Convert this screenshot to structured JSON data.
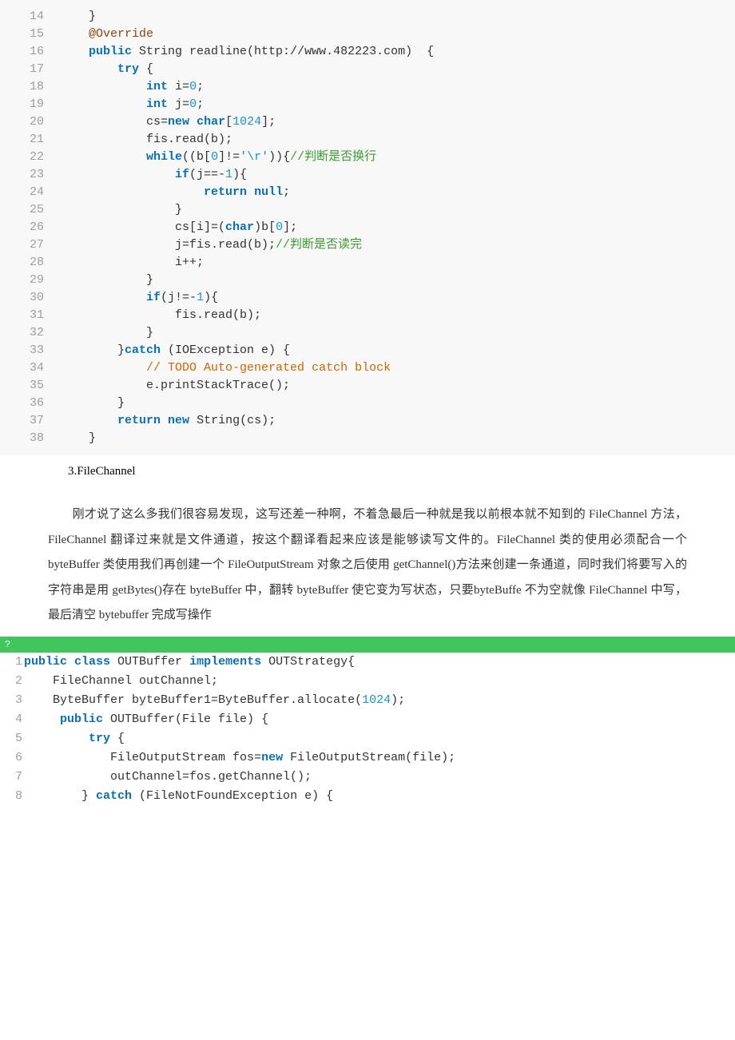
{
  "code1": [
    {
      "n": "14",
      "tokens": [
        {
          "t": "    }",
          "c": ""
        }
      ]
    },
    {
      "n": "15",
      "tokens": [
        {
          "t": "    @Override",
          "c": "brown"
        }
      ]
    },
    {
      "n": "16",
      "tokens": [
        {
          "t": "    ",
          "c": ""
        },
        {
          "t": "public",
          "c": "kw"
        },
        {
          "t": " String readline(http://www.482223.com)  {",
          "c": ""
        }
      ]
    },
    {
      "n": "17",
      "tokens": [
        {
          "t": "        ",
          "c": ""
        },
        {
          "t": "try",
          "c": "kw"
        },
        {
          "t": " {",
          "c": ""
        }
      ]
    },
    {
      "n": "18",
      "tokens": [
        {
          "t": "            ",
          "c": ""
        },
        {
          "t": "int",
          "c": "kw"
        },
        {
          "t": " i=",
          "c": ""
        },
        {
          "t": "0",
          "c": "num"
        },
        {
          "t": ";",
          "c": ""
        }
      ]
    },
    {
      "n": "19",
      "tokens": [
        {
          "t": "            ",
          "c": ""
        },
        {
          "t": "int",
          "c": "kw"
        },
        {
          "t": " j=",
          "c": ""
        },
        {
          "t": "0",
          "c": "num"
        },
        {
          "t": ";",
          "c": ""
        }
      ]
    },
    {
      "n": "20",
      "tokens": [
        {
          "t": "            cs=",
          "c": ""
        },
        {
          "t": "new",
          "c": "kw"
        },
        {
          "t": " ",
          "c": ""
        },
        {
          "t": "char",
          "c": "kw"
        },
        {
          "t": "[",
          "c": ""
        },
        {
          "t": "1024",
          "c": "num"
        },
        {
          "t": "];",
          "c": ""
        }
      ]
    },
    {
      "n": "21",
      "tokens": [
        {
          "t": "            fis.read(b);",
          "c": ""
        }
      ]
    },
    {
      "n": "22",
      "tokens": [
        {
          "t": "            ",
          "c": ""
        },
        {
          "t": "while",
          "c": "kw"
        },
        {
          "t": "((b[",
          "c": ""
        },
        {
          "t": "0",
          "c": "num"
        },
        {
          "t": "]!=",
          "c": ""
        },
        {
          "t": "'\\r'",
          "c": "str"
        },
        {
          "t": ")){",
          "c": ""
        },
        {
          "t": "//判断是否换行",
          "c": "cmt-g"
        }
      ]
    },
    {
      "n": "23",
      "tokens": [
        {
          "t": "                ",
          "c": ""
        },
        {
          "t": "if",
          "c": "kw"
        },
        {
          "t": "(j==-",
          "c": ""
        },
        {
          "t": "1",
          "c": "num"
        },
        {
          "t": "){",
          "c": ""
        }
      ]
    },
    {
      "n": "24",
      "tokens": [
        {
          "t": "                    ",
          "c": ""
        },
        {
          "t": "return",
          "c": "kw"
        },
        {
          "t": " ",
          "c": ""
        },
        {
          "t": "null",
          "c": "kw"
        },
        {
          "t": ";",
          "c": ""
        }
      ]
    },
    {
      "n": "25",
      "tokens": [
        {
          "t": "                }",
          "c": ""
        }
      ]
    },
    {
      "n": "26",
      "tokens": [
        {
          "t": "                cs[i]=(",
          "c": ""
        },
        {
          "t": "char",
          "c": "kw"
        },
        {
          "t": ")b[",
          "c": ""
        },
        {
          "t": "0",
          "c": "num"
        },
        {
          "t": "];",
          "c": ""
        }
      ]
    },
    {
      "n": "27",
      "tokens": [
        {
          "t": "                j=fis.read(b);",
          "c": ""
        },
        {
          "t": "//判断是否读完",
          "c": "cmt-g"
        }
      ]
    },
    {
      "n": "28",
      "tokens": [
        {
          "t": "                i++;",
          "c": ""
        }
      ]
    },
    {
      "n": "29",
      "tokens": [
        {
          "t": "            }",
          "c": ""
        }
      ]
    },
    {
      "n": "30",
      "tokens": [
        {
          "t": "            ",
          "c": ""
        },
        {
          "t": "if",
          "c": "kw"
        },
        {
          "t": "(j!=-",
          "c": ""
        },
        {
          "t": "1",
          "c": "num"
        },
        {
          "t": "){",
          "c": ""
        }
      ]
    },
    {
      "n": "31",
      "tokens": [
        {
          "t": "                fis.read(b);",
          "c": ""
        }
      ]
    },
    {
      "n": "32",
      "tokens": [
        {
          "t": "            }",
          "c": ""
        }
      ]
    },
    {
      "n": "33",
      "tokens": [
        {
          "t": "        }",
          "c": ""
        },
        {
          "t": "catch",
          "c": "kw"
        },
        {
          "t": " (IOException e) {",
          "c": ""
        }
      ]
    },
    {
      "n": "34",
      "tokens": [
        {
          "t": "            ",
          "c": ""
        },
        {
          "t": "// TODO Auto-generated catch block",
          "c": "cmt-o"
        }
      ]
    },
    {
      "n": "35",
      "tokens": [
        {
          "t": "            e.printStackTrace();",
          "c": ""
        }
      ]
    },
    {
      "n": "36",
      "tokens": [
        {
          "t": "        }",
          "c": ""
        }
      ]
    },
    {
      "n": "37",
      "tokens": [
        {
          "t": "        ",
          "c": ""
        },
        {
          "t": "return",
          "c": "kw"
        },
        {
          "t": " ",
          "c": ""
        },
        {
          "t": "new",
          "c": "kw"
        },
        {
          "t": " String(cs);",
          "c": ""
        }
      ]
    },
    {
      "n": "38",
      "tokens": [
        {
          "t": "    }",
          "c": ""
        }
      ]
    }
  ],
  "sect": "3.FileChannel",
  "prose": "　　刚才说了这么多我们很容易发现，这写还差一种啊，不着急最后一种就是我以前根本就不知到的 FileChannel 方法，FileChannel 翻译过来就是文件通道，按这个翻译看起来应该是能够读写文件的。FileChannel 类的使用必须配合一个 byteBuffer 类使用我们再创建一个 FileOutputStream 对象之后使用 getChannel()方法来创建一条通道，同时我们将要写入的字符串是用 getBytes()存在 byteBuffer 中，翻转 byteBuffer 使它变为写状态，只要byteBuffe 不为空就像 FileChannel 中写，最后清空 bytebuffer 完成写操作",
  "greenbar": "?",
  "code2": [
    {
      "n": "1",
      "tokens": [
        {
          "t": "public",
          "c": "kw"
        },
        {
          "t": " ",
          "c": ""
        },
        {
          "t": "class",
          "c": "kw"
        },
        {
          "t": " OUTBuffer ",
          "c": ""
        },
        {
          "t": "implements",
          "c": "kw"
        },
        {
          "t": " OUTStrategy{",
          "c": ""
        }
      ]
    },
    {
      "n": "2",
      "tokens": [
        {
          "t": "    FileChannel outChannel;",
          "c": ""
        }
      ]
    },
    {
      "n": "3",
      "tokens": [
        {
          "t": "    ByteBuffer byteBuffer1=ByteBuffer.allocate(",
          "c": ""
        },
        {
          "t": "1024",
          "c": "num"
        },
        {
          "t": ");",
          "c": ""
        }
      ]
    },
    {
      "n": "4",
      "tokens": [
        {
          "t": "     ",
          "c": ""
        },
        {
          "t": "public",
          "c": "kw"
        },
        {
          "t": " OUTBuffer(File file) {",
          "c": ""
        }
      ]
    },
    {
      "n": "5",
      "tokens": [
        {
          "t": "         ",
          "c": ""
        },
        {
          "t": "try",
          "c": "kw"
        },
        {
          "t": " {",
          "c": ""
        }
      ]
    },
    {
      "n": "6",
      "tokens": [
        {
          "t": "            FileOutputStream fos=",
          "c": ""
        },
        {
          "t": "new",
          "c": "kw"
        },
        {
          "t": " FileOutputStream(file);",
          "c": ""
        }
      ]
    },
    {
      "n": "7",
      "tokens": [
        {
          "t": "            outChannel=fos.getChannel();",
          "c": ""
        }
      ]
    },
    {
      "n": "8",
      "tokens": [
        {
          "t": "        } ",
          "c": ""
        },
        {
          "t": "catch",
          "c": "kw"
        },
        {
          "t": " (FileNotFoundException e) {",
          "c": ""
        }
      ]
    }
  ]
}
